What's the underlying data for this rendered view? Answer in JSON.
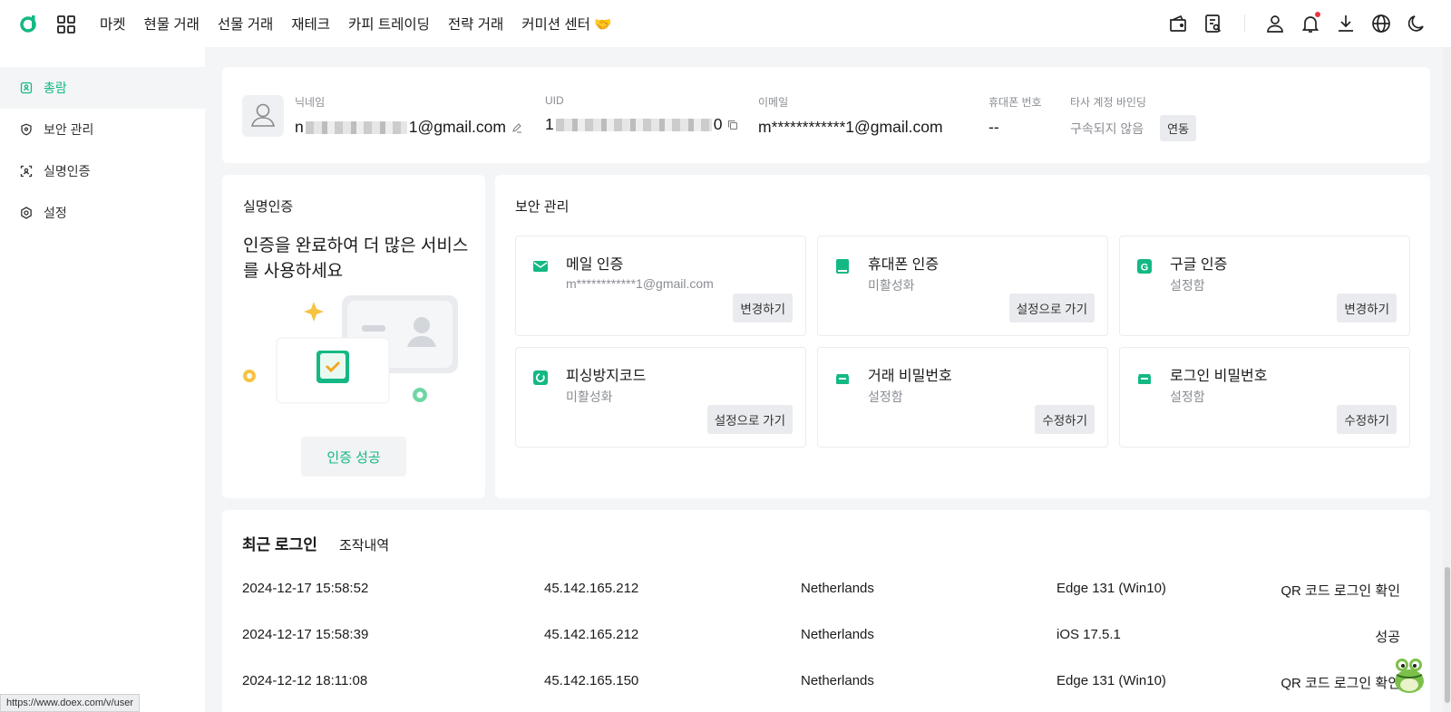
{
  "colors": {
    "accent": "#14b884",
    "danger": "#ee3344",
    "bg": "#f4f5f6"
  },
  "nav": {
    "items": [
      "마켓",
      "현물 거래",
      "선물 거래",
      "재테크",
      "카피 트레이딩",
      "전략 거래",
      "커미션 센터 🤝"
    ]
  },
  "toolbar_icons": [
    "wallet-icon",
    "orders-icon",
    "user-icon",
    "bell-icon",
    "download-icon",
    "globe-icon",
    "moon-icon"
  ],
  "sidebar": {
    "items": [
      {
        "label": "총람",
        "icon": "overview-icon",
        "active": true
      },
      {
        "label": "보안 관리",
        "icon": "shield-icon",
        "active": false
      },
      {
        "label": "실명인증",
        "icon": "id-scan-icon",
        "active": false
      },
      {
        "label": "설정",
        "icon": "gear-icon",
        "active": false
      }
    ]
  },
  "profile": {
    "nickname_label": "닉네임",
    "nickname_start": "n",
    "nickname_end": "1@gmail.com",
    "uid_label": "UID",
    "uid_start": "1",
    "uid_end": "0",
    "email_label": "이메일",
    "email": "m************1@gmail.com",
    "phone_label": "휴대폰 번호",
    "phone": "--",
    "binding_label": "타사 계정 바인딩",
    "binding_status": "구속되지 않음",
    "binding_button": "연동"
  },
  "verification": {
    "title": "실명인증",
    "description": "인증을 완료하여 더 많은 서비스를 사용하세요",
    "status_button": "인증 성공"
  },
  "security": {
    "title": "보안 관리",
    "items": [
      {
        "title": "메일 인증",
        "status": "m************1@gmail.com",
        "button": "변경하기",
        "icon": "mail-icon"
      },
      {
        "title": "휴대폰 인증",
        "status": "미활성화",
        "button": "설정으로 가기",
        "icon": "phone-icon"
      },
      {
        "title": "구글 인증",
        "status": "설정함",
        "button": "변경하기",
        "icon": "google-auth-icon"
      },
      {
        "title": "피싱방지코드",
        "status": "미활성화",
        "button": "설정으로 가기",
        "icon": "anti-phishing-icon"
      },
      {
        "title": "거래 비밀번호",
        "status": "설정함",
        "button": "수정하기",
        "icon": "lock-icon"
      },
      {
        "title": "로그인 비밀번호",
        "status": "설정함",
        "button": "수정하기",
        "icon": "lock-icon"
      }
    ]
  },
  "logins": {
    "tab_active": "최근 로그인",
    "tab_other": "조작내역",
    "rows": [
      {
        "time": "2024-12-17 15:58:52",
        "ip": "45.142.165.212",
        "country": "Netherlands",
        "device": "Edge 131 (Win10)",
        "result": "QR 코드 로그인 확인"
      },
      {
        "time": "2024-12-17 15:58:39",
        "ip": "45.142.165.212",
        "country": "Netherlands",
        "device": "iOS 17.5.1",
        "result": "성공"
      },
      {
        "time": "2024-12-12 18:11:08",
        "ip": "45.142.165.150",
        "country": "Netherlands",
        "device": "Edge 131 (Win10)",
        "result": "QR 코드 로그인 확인"
      }
    ]
  },
  "statusbar": {
    "url": "https://www.doex.com/v/user"
  }
}
